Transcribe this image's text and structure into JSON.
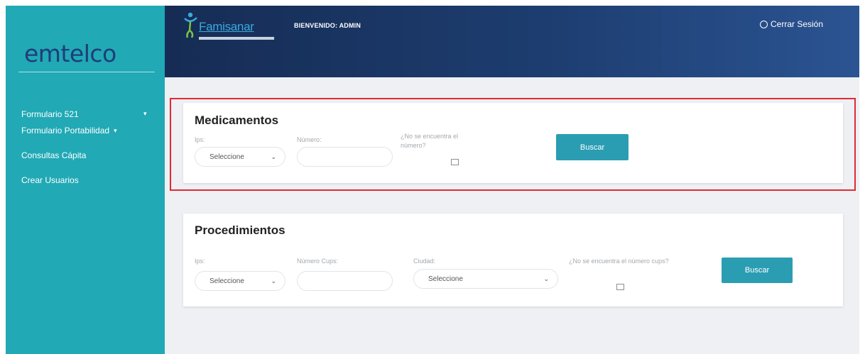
{
  "sidebar": {
    "logo": "emtelco",
    "items": [
      {
        "label": "Formulario 521",
        "caret": "▾"
      },
      {
        "label": "Formulario Portabilidad",
        "caret": "▾"
      },
      {
        "label": "Consultas Cápita"
      },
      {
        "label": "Crear Usuarios"
      }
    ]
  },
  "header": {
    "brand": "Famisanar",
    "welcome": "BIENVENIDO: ADMIN",
    "logout": "Cerrar Sesión"
  },
  "medicamentos": {
    "title": "Medicamentos",
    "ips_label": "Ips:",
    "ips_value": "Seleccione",
    "numero_label": "Número:",
    "numero_value": "",
    "no_encuentra_label": "¿No se encuentra el número?",
    "no_encuentra_checked": false,
    "buscar": "Buscar"
  },
  "procedimientos": {
    "title": "Procedimientos",
    "ips_label": "Ips:",
    "ips_value": "Seleccione",
    "numero_cups_label": "Número Cups:",
    "numero_cups_value": "",
    "ciudad_label": "Ciudad:",
    "ciudad_value": "Seleccione",
    "no_encuentra_label": "¿No se encuentra el número cups?",
    "no_encuentra_checked": false,
    "buscar": "Buscar"
  },
  "colors": {
    "sidebar": "#21a9b5",
    "header": "#1d3d70",
    "button": "#2b9db2",
    "highlight": "#e02a35"
  }
}
